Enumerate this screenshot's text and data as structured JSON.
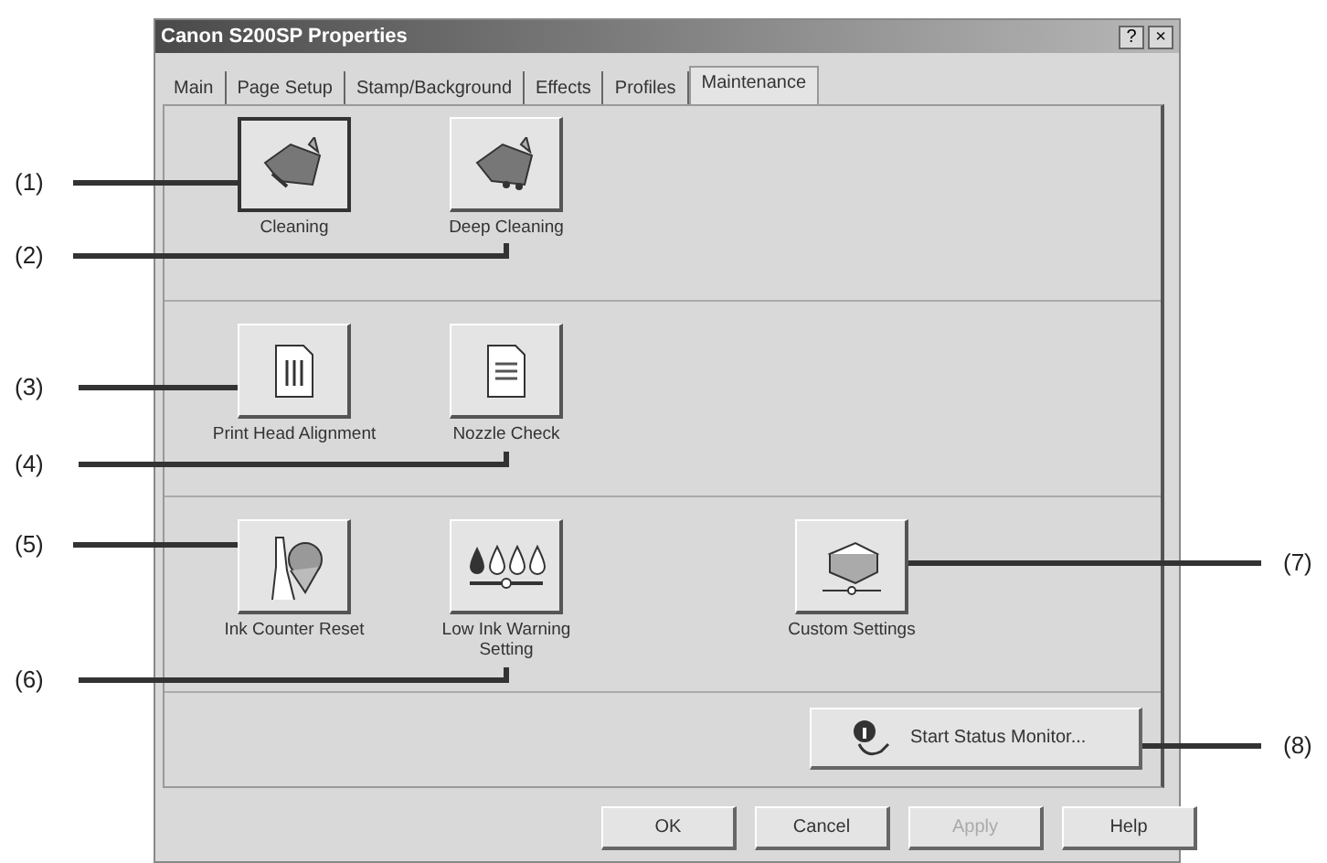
{
  "window": {
    "title": "Canon S200SP Properties",
    "controls": [
      "?",
      "×"
    ]
  },
  "tabs": [
    {
      "label": "Main",
      "selected": false
    },
    {
      "label": "Page Setup",
      "selected": false
    },
    {
      "label": "Stamp/Background",
      "selected": false
    },
    {
      "label": "Effects",
      "selected": false
    },
    {
      "label": "Profiles",
      "selected": false
    },
    {
      "label": "Maintenance",
      "selected": true
    }
  ],
  "sections": [
    {
      "tools": [
        {
          "kind": "cleaning",
          "label": "Cleaning",
          "focused": true
        },
        {
          "kind": "deep-cleaning",
          "label": "Deep Cleaning",
          "focused": false
        }
      ]
    },
    {
      "tools": [
        {
          "kind": "alignment",
          "label": "Print Head Alignment",
          "focused": false
        },
        {
          "kind": "nozzle",
          "label": "Nozzle Check",
          "focused": false
        }
      ]
    },
    {
      "tools": [
        {
          "kind": "ink-reset",
          "label": "Ink Counter Reset",
          "focused": false
        },
        {
          "kind": "ink-warning",
          "label": "Low Ink Warning Setting",
          "focused": false
        },
        {
          "kind": "custom",
          "label": "Custom Settings",
          "focused": false
        }
      ]
    }
  ],
  "status_button": {
    "label": "Start Status Monitor..."
  },
  "buttons": [
    {
      "label": "OK",
      "disabled": false
    },
    {
      "label": "Cancel",
      "disabled": false
    },
    {
      "label": "Apply",
      "disabled": true
    },
    {
      "label": "Help",
      "disabled": false
    }
  ],
  "callouts": [
    {
      "label": "(1)"
    },
    {
      "label": "(2)"
    },
    {
      "label": "(3)"
    },
    {
      "label": "(4)"
    },
    {
      "label": "(5)"
    },
    {
      "label": "(6)"
    },
    {
      "label": "(7)"
    },
    {
      "label": "(8)"
    }
  ]
}
